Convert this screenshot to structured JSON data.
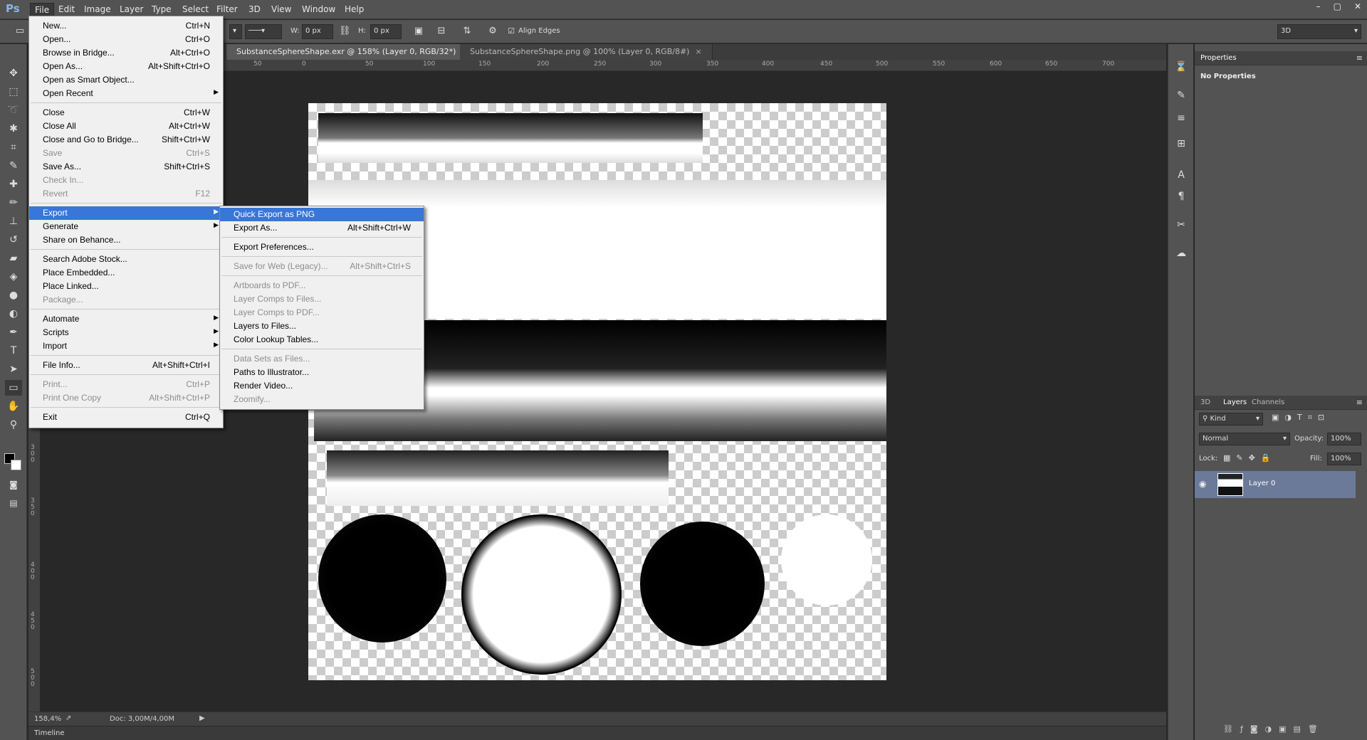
{
  "app": {
    "logo": "Ps"
  },
  "menubar": [
    "File",
    "Edit",
    "Image",
    "Layer",
    "Type",
    "Select",
    "Filter",
    "3D",
    "View",
    "Window",
    "Help"
  ],
  "window_controls": [
    "–",
    "▢",
    "✕"
  ],
  "options": {
    "w_label": "W:",
    "w_value": "0 px",
    "h_label": "H:",
    "h_value": "0 px",
    "align_edges": "Align Edges",
    "workspace": "3D"
  },
  "tabs": [
    {
      "label": "SubstanceSphereShape.exr @ 158% (Layer 0, RGB/32*)",
      "active": true
    },
    {
      "label": "SubstanceSphereShape.png @ 100% (Layer 0, RGB/8#)",
      "active": false
    }
  ],
  "ruler_h": [
    "50",
    "0",
    "50",
    "100",
    "150",
    "200",
    "250",
    "300",
    "350",
    "400",
    "450",
    "500",
    "550",
    "600",
    "650",
    "700"
  ],
  "ruler_v": [
    "3 0 0",
    "3 5 0",
    "4 0 0",
    "4 5 0",
    "5 0 0"
  ],
  "status": {
    "zoom": "158,4%",
    "doc": "Doc: 3,00M/4,00M"
  },
  "timeline": "Timeline",
  "file_menu": [
    {
      "label": "New...",
      "shortcut": "Ctrl+N"
    },
    {
      "label": "Open...",
      "shortcut": "Ctrl+O"
    },
    {
      "label": "Browse in Bridge...",
      "shortcut": "Alt+Ctrl+O"
    },
    {
      "label": "Open As...",
      "shortcut": "Alt+Shift+Ctrl+O"
    },
    {
      "label": "Open as Smart Object...",
      "shortcut": ""
    },
    {
      "label": "Open Recent",
      "shortcut": ""
    },
    {
      "label": "Close",
      "shortcut": "Ctrl+W"
    },
    {
      "label": "Close All",
      "shortcut": "Alt+Ctrl+W"
    },
    {
      "label": "Close and Go to Bridge...",
      "shortcut": "Shift+Ctrl+W"
    },
    {
      "label": "Save",
      "shortcut": "Ctrl+S"
    },
    {
      "label": "Save As...",
      "shortcut": "Shift+Ctrl+S"
    },
    {
      "label": "Check In...",
      "shortcut": ""
    },
    {
      "label": "Revert",
      "shortcut": "F12"
    },
    {
      "label": "Export",
      "shortcut": ""
    },
    {
      "label": "Generate",
      "shortcut": ""
    },
    {
      "label": "Share on Behance...",
      "shortcut": ""
    },
    {
      "label": "Search Adobe Stock...",
      "shortcut": ""
    },
    {
      "label": "Place Embedded...",
      "shortcut": ""
    },
    {
      "label": "Place Linked...",
      "shortcut": ""
    },
    {
      "label": "Package...",
      "shortcut": ""
    },
    {
      "label": "Automate",
      "shortcut": ""
    },
    {
      "label": "Scripts",
      "shortcut": ""
    },
    {
      "label": "Import",
      "shortcut": ""
    },
    {
      "label": "File Info...",
      "shortcut": "Alt+Shift+Ctrl+I"
    },
    {
      "label": "Print...",
      "shortcut": "Ctrl+P"
    },
    {
      "label": "Print One Copy",
      "shortcut": "Alt+Shift+Ctrl+P"
    },
    {
      "label": "Exit",
      "shortcut": "Ctrl+Q"
    }
  ],
  "export_menu": [
    {
      "label": "Quick Export as PNG",
      "shortcut": ""
    },
    {
      "label": "Export As...",
      "shortcut": "Alt+Shift+Ctrl+W"
    },
    {
      "label": "Export Preferences...",
      "shortcut": ""
    },
    {
      "label": "Save for Web (Legacy)...",
      "shortcut": "Alt+Shift+Ctrl+S"
    },
    {
      "label": "Artboards to PDF...",
      "shortcut": ""
    },
    {
      "label": "Layer Comps to Files...",
      "shortcut": ""
    },
    {
      "label": "Layer Comps to PDF...",
      "shortcut": ""
    },
    {
      "label": "Layers to Files...",
      "shortcut": ""
    },
    {
      "label": "Color Lookup Tables...",
      "shortcut": ""
    },
    {
      "label": "Data Sets as Files...",
      "shortcut": ""
    },
    {
      "label": "Paths to Illustrator...",
      "shortcut": ""
    },
    {
      "label": "Render Video...",
      "shortcut": ""
    },
    {
      "label": "Zoomify...",
      "shortcut": ""
    }
  ],
  "properties": {
    "tab": "Properties",
    "text": "No Properties"
  },
  "layers_panel": {
    "tabs": [
      "3D",
      "Layers",
      "Channels"
    ],
    "kind": "Kind",
    "blend": "Normal",
    "opacity_label": "Opacity:",
    "opacity": "100%",
    "lock_label": "Lock:",
    "fill_label": "Fill:",
    "fill": "100%",
    "layer_name": "Layer 0"
  }
}
